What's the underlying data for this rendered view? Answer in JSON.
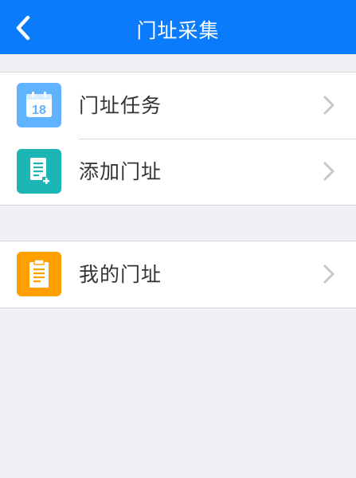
{
  "header": {
    "title": "门址采集",
    "back_icon": "chevron-left-icon",
    "background": "#0a7cfb"
  },
  "menu": {
    "group1": [
      {
        "label": "门址任务",
        "icon": "calendar-icon",
        "icon_text": "18",
        "icon_color": "#5fb3ff"
      },
      {
        "label": "添加门址",
        "icon": "add-document-icon",
        "icon_color": "#1bb5b3"
      }
    ],
    "group2": [
      {
        "label": "我的门址",
        "icon": "clipboard-icon",
        "icon_color": "#ffa000"
      }
    ]
  }
}
